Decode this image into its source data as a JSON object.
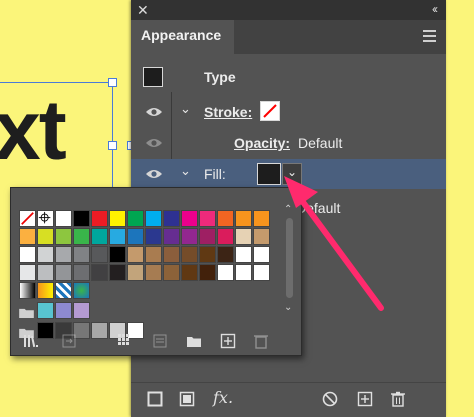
{
  "canvas": {
    "text": "xt"
  },
  "panel": {
    "tab_label": "Appearance",
    "rows": {
      "type_label": "Type",
      "stroke_label": "Stroke:",
      "opacity_label": "Opacity:",
      "opacity_value": "Default",
      "fill_label": "Fill:",
      "default_label": "Default"
    }
  },
  "icons": [
    "close-icon",
    "collapse-icon",
    "panel-menu-icon",
    "eye-icon",
    "chevron-down-icon",
    "new-stroke-icon",
    "new-fill-icon",
    "fx-icon",
    "clear-appearance-icon",
    "duplicate-icon",
    "trash-icon",
    "swatch-libraries-icon",
    "place-swatches-icon",
    "swatch-kinds-icon",
    "swatch-options-icon",
    "new-color-group-icon",
    "new-swatch-icon",
    "delete-swatch-icon"
  ],
  "colors": {
    "accent": "#ff2a6d",
    "panel_bg": "#535353",
    "highlight_row": "#4a5f7e",
    "selection_blue": "#4a7bd8"
  },
  "swatches": {
    "row1": [
      "none",
      "registration",
      "#ffffff",
      "#000000",
      "#ed1c24",
      "#fff200",
      "#00a651",
      "#00aeef",
      "#2e3192",
      "#ec008c",
      "#ee2a7b",
      "#f26522",
      "#f7941d",
      "#f7941d"
    ],
    "row2": [
      "#fbb040",
      "#d7df23",
      "#8dc63f",
      "#39b54a",
      "#00a79d",
      "#27aae1",
      "#1c75bc",
      "#2b388f",
      "#662d91",
      "#92278f",
      "#9e1f63",
      "#da1c5c",
      "#e6d2b4",
      "#c49a6c"
    ],
    "row3": [
      "#ffffff",
      "#d1d3d4",
      "#a7a9ac",
      "#808285",
      "#58595b",
      "#000000",
      "#c49a6c",
      "#a97c50",
      "#8b5e3c",
      "#754c29",
      "#603913",
      "#3c2415",
      "#ffffff",
      "#ffffff"
    ],
    "row4": [
      "#e6e7e8",
      "#bcbec0",
      "#939598",
      "#6d6e71",
      "#414042",
      "#231f20",
      "#c2a47b",
      "#a67c52",
      "#8c6239",
      "#603813",
      "#42210b",
      "#ffffff",
      "#ffffff",
      "#ffffff"
    ]
  }
}
